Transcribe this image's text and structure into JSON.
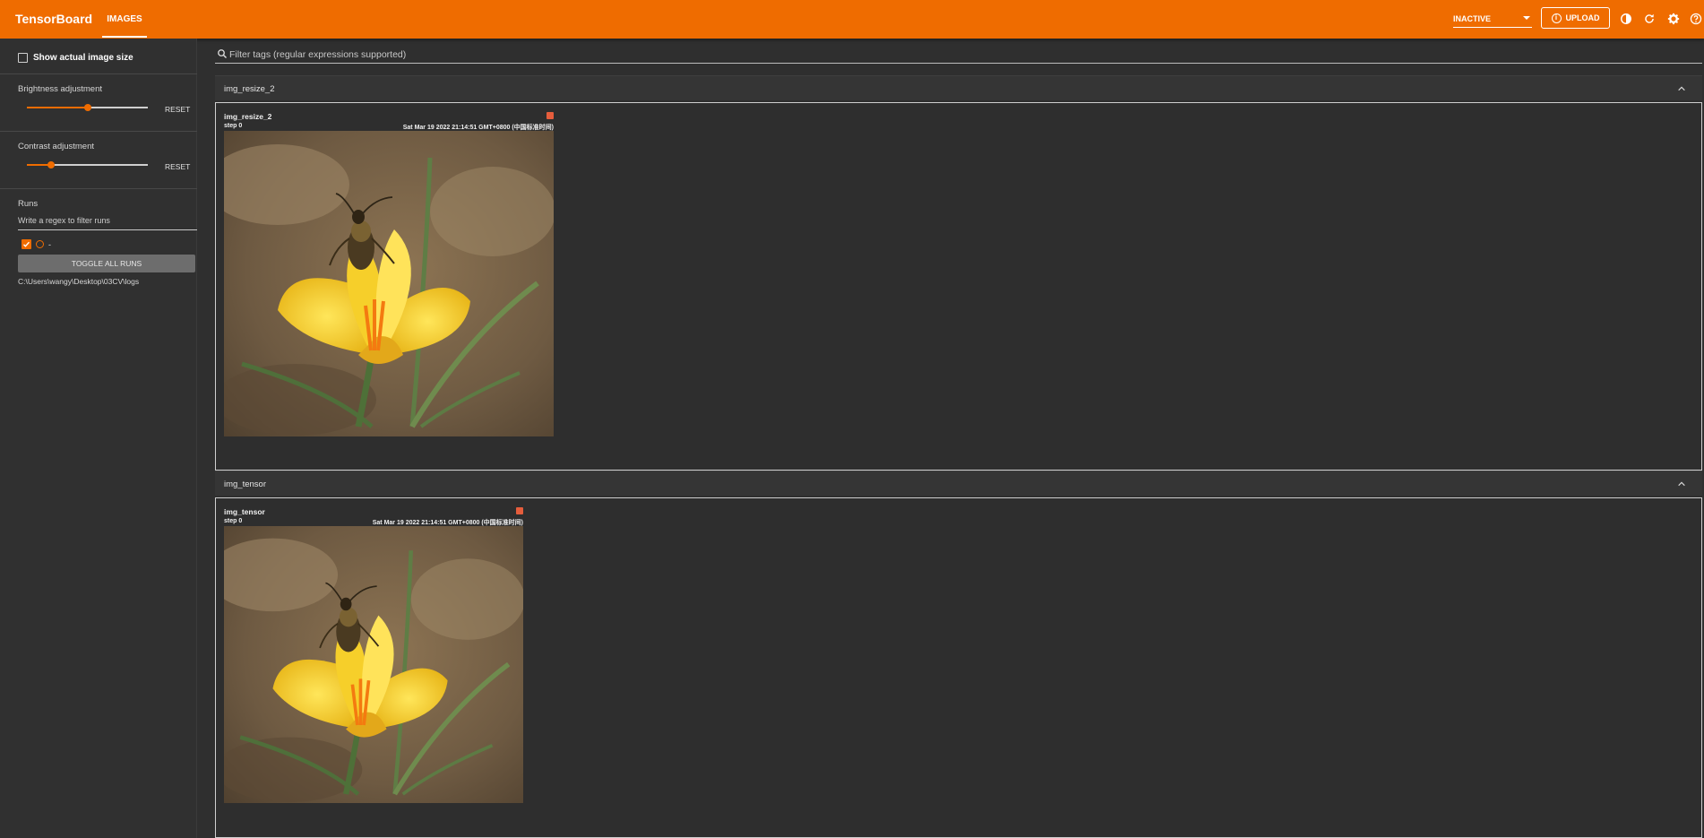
{
  "header": {
    "brand": "TensorBoard",
    "tab_images": "IMAGES",
    "status": "INACTIVE",
    "upload": "UPLOAD",
    "accent": "#ef6c00"
  },
  "sidebar": {
    "show_actual_size": "Show actual image size",
    "brightness_label": "Brightness adjustment",
    "brightness_value": 0.5,
    "contrast_label": "Contrast adjustment",
    "contrast_value": 0.2,
    "reset": "RESET",
    "runs_label": "Runs",
    "regex_placeholder": "Write a regex to filter runs",
    "run_name": "-",
    "toggle_all": "TOGGLE ALL RUNS",
    "logdir": "C:\\Users\\wangy\\Desktop\\03CV\\logs"
  },
  "main": {
    "filter_placeholder": "Filter tags (regular expressions supported)",
    "cards": [
      {
        "tag": "img_resize_2",
        "image_title": "img_resize_2",
        "step": "step 0",
        "timestamp": "Sat Mar 19 2022 21:14:51 GMT+0800 (中国标准时间)"
      },
      {
        "tag": "img_tensor",
        "image_title": "img_tensor",
        "step": "step 0",
        "timestamp": "Sat Mar 19 2022 21:14:51 GMT+0800 (中国标准时间)"
      }
    ]
  }
}
